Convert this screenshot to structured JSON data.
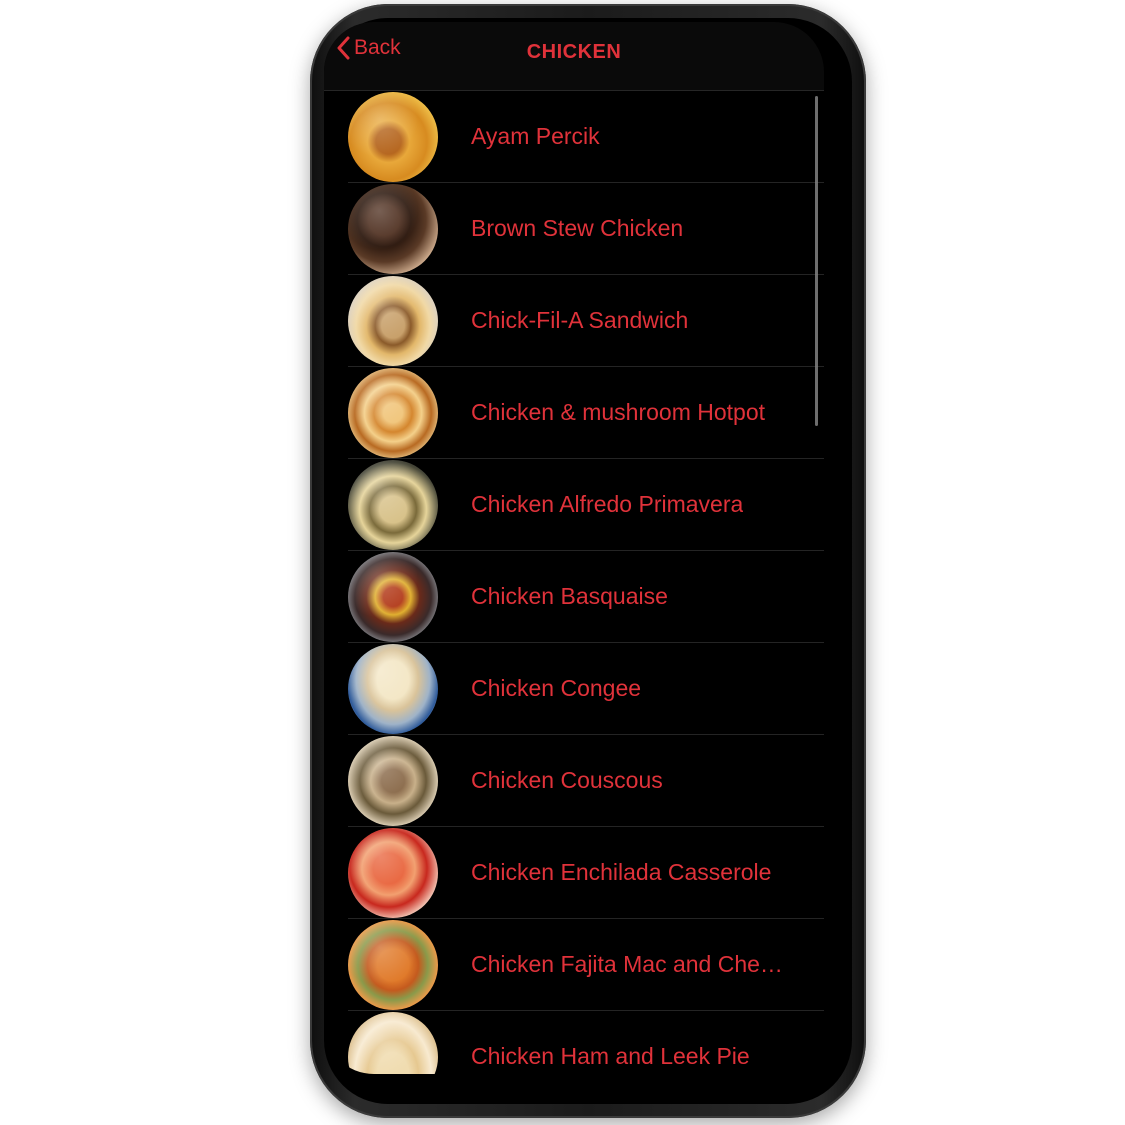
{
  "nav": {
    "back_label": "Back",
    "title": "CHICKEN"
  },
  "meals": [
    {
      "name": "Ayam Percik",
      "icon": "meal-photo"
    },
    {
      "name": "Brown Stew Chicken",
      "icon": "meal-photo"
    },
    {
      "name": "Chick-Fil-A Sandwich",
      "icon": "meal-photo"
    },
    {
      "name": "Chicken & mushroom Hotpot",
      "icon": "meal-photo"
    },
    {
      "name": "Chicken Alfredo Primavera",
      "icon": "meal-photo"
    },
    {
      "name": "Chicken Basquaise",
      "icon": "meal-photo"
    },
    {
      "name": "Chicken Congee",
      "icon": "meal-photo"
    },
    {
      "name": "Chicken Couscous",
      "icon": "meal-photo"
    },
    {
      "name": "Chicken Enchilada Casserole",
      "icon": "meal-photo"
    },
    {
      "name": "Chicken Fajita Mac and Che…",
      "icon": "meal-photo"
    },
    {
      "name": "Chicken Ham and Leek Pie",
      "icon": "meal-photo"
    }
  ],
  "theme": {
    "accent": "#e0323a",
    "background": "#000000",
    "divider": "#242424"
  }
}
